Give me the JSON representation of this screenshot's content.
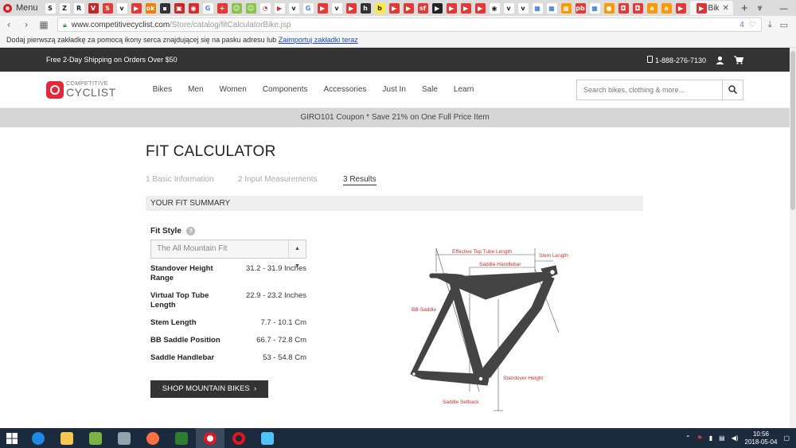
{
  "browser": {
    "menu_label": "Menu",
    "active_tab_title": "Bik",
    "url_host": "www.competitivecyclist.com",
    "url_path": "/Store/catalog/fitCalculatorBike.jsp",
    "url_badge_count": "4",
    "bookmark_hint": "Dodaj pierwszą zakładkę za pomocą ikony serca znajdującej się na pasku adresu lub",
    "bookmark_link": "Zaimportuj zakładki teraz",
    "tab_favicons": [
      {
        "letter": "S",
        "color": "#ffffff",
        "fg": "#222"
      },
      {
        "letter": "Z",
        "color": "#ffffff",
        "fg": "#222"
      },
      {
        "letter": "R",
        "color": "#ffffff",
        "fg": "#222"
      },
      {
        "letter": "V",
        "color": "#c62828",
        "fg": "#fff"
      },
      {
        "letter": "S",
        "color": "#e53935",
        "fg": "#fff"
      },
      {
        "letter": "v",
        "color": "#ffffff",
        "fg": "#222"
      },
      {
        "letter": "▶",
        "color": "#e53935",
        "fg": "#fff"
      },
      {
        "letter": "ok",
        "color": "#f57c00",
        "fg": "#fff"
      },
      {
        "letter": "▪",
        "color": "#333333",
        "fg": "#fff"
      },
      {
        "letter": "▣",
        "color": "#c62828",
        "fg": "#fff"
      },
      {
        "letter": "◉",
        "color": "#d32f2f",
        "fg": "#fff"
      },
      {
        "letter": "G",
        "color": "#ffffff",
        "fg": "#4285f4"
      },
      {
        "letter": "+",
        "color": "#e53935",
        "fg": "#fff"
      },
      {
        "letter": "☺",
        "color": "#8bc34a",
        "fg": "#fff"
      },
      {
        "letter": "☺",
        "color": "#8bc34a",
        "fg": "#fff"
      },
      {
        "letter": "◔",
        "color": "#ffffff",
        "fg": "#d32f2f"
      },
      {
        "letter": "▶",
        "color": "#ffffff",
        "fg": "#d32f2f"
      },
      {
        "letter": "v",
        "color": "#ffffff",
        "fg": "#222"
      },
      {
        "letter": "G",
        "color": "#ffffff",
        "fg": "#4285f4"
      },
      {
        "letter": "▶",
        "color": "#e53935",
        "fg": "#fff"
      },
      {
        "letter": "v",
        "color": "#ffffff",
        "fg": "#222"
      },
      {
        "letter": "▶",
        "color": "#e53935",
        "fg": "#fff"
      },
      {
        "letter": "h",
        "color": "#333333",
        "fg": "#fff"
      },
      {
        "letter": "b",
        "color": "#ffeb3b",
        "fg": "#222"
      },
      {
        "letter": "▶",
        "color": "#e53935",
        "fg": "#fff"
      },
      {
        "letter": "▶",
        "color": "#e53935",
        "fg": "#fff"
      },
      {
        "letter": "sf",
        "color": "#e53935",
        "fg": "#fff"
      },
      {
        "letter": "▶",
        "color": "#222222",
        "fg": "#fff"
      },
      {
        "letter": "▶",
        "color": "#e53935",
        "fg": "#fff"
      },
      {
        "letter": "▶",
        "color": "#e53935",
        "fg": "#fff"
      },
      {
        "letter": "▶",
        "color": "#e53935",
        "fg": "#fff"
      },
      {
        "letter": "◉",
        "color": "#ffffff",
        "fg": "#222"
      },
      {
        "letter": "v",
        "color": "#ffffff",
        "fg": "#222"
      },
      {
        "letter": "v",
        "color": "#ffffff",
        "fg": "#222"
      },
      {
        "letter": "▦",
        "color": "#ffffff",
        "fg": "#1565c0"
      },
      {
        "letter": "▦",
        "color": "#ffffff",
        "fg": "#1565c0"
      },
      {
        "letter": "▦",
        "color": "#ff9800",
        "fg": "#fff"
      },
      {
        "letter": "pb",
        "color": "#e53935",
        "fg": "#fff"
      },
      {
        "letter": "▦",
        "color": "#ffffff",
        "fg": "#1565c0"
      },
      {
        "letter": "●",
        "color": "#ff9800",
        "fg": "#fff"
      },
      {
        "letter": "◘",
        "color": "#e53935",
        "fg": "#fff"
      },
      {
        "letter": "◘",
        "color": "#e53935",
        "fg": "#fff"
      },
      {
        "letter": "a",
        "color": "#ff9800",
        "fg": "#fff"
      },
      {
        "letter": "a",
        "color": "#ff9800",
        "fg": "#fff"
      },
      {
        "letter": "▶",
        "color": "#e53935",
        "fg": "#fff"
      }
    ]
  },
  "site": {
    "shipping": "Free 2-Day Shipping on Orders Over $50",
    "phone": "1-888-276-7130",
    "logo_top": "COMPETITIVE",
    "logo_bottom": "CYCLIST",
    "nav": [
      "Bikes",
      "Men",
      "Women",
      "Components",
      "Accessories",
      "Just In",
      "Sale",
      "Learn"
    ],
    "search_placeholder": "Search bikes, clothing & more...",
    "coupon": "GIRO101 Coupon * Save 21% on One Full Price Item",
    "brand_color": "#e2283a"
  },
  "page": {
    "title": "FIT CALCULATOR",
    "steps": [
      "1 Basic Information",
      "2 Input Measurements",
      "3 Results"
    ],
    "summary_heading": "YOUR FIT SUMMARY",
    "fit_style_label": "Fit Style",
    "fit_style_value": "The All Mountain Fit",
    "results": [
      {
        "label": "Standover Height Range",
        "value": "31.2 - 31.9 Inches"
      },
      {
        "label": "Virtual Top Tube Length",
        "value": "22.9 - 23.2 Inches"
      },
      {
        "label": "Stem Length",
        "value": "7.7 - 10.1 Cm"
      },
      {
        "label": "BB Saddle Position",
        "value": "66.7 - 72.8 Cm"
      },
      {
        "label": "Saddle Handlebar",
        "value": "53 - 54.8 Cm"
      }
    ],
    "shop_button": "SHOP MOUNTAIN BIKES",
    "diagram_labels": {
      "top_tube": "Effective Top Tube Length",
      "stem": "Stem Length",
      "saddle_handlebar": "Saddle-Handlebar",
      "bb_saddle": "BB-Saddle",
      "standover": "Standover Height",
      "setback": "Saddle Setback"
    }
  },
  "taskbar": {
    "time": "10:56",
    "date": "2018-05-04"
  }
}
